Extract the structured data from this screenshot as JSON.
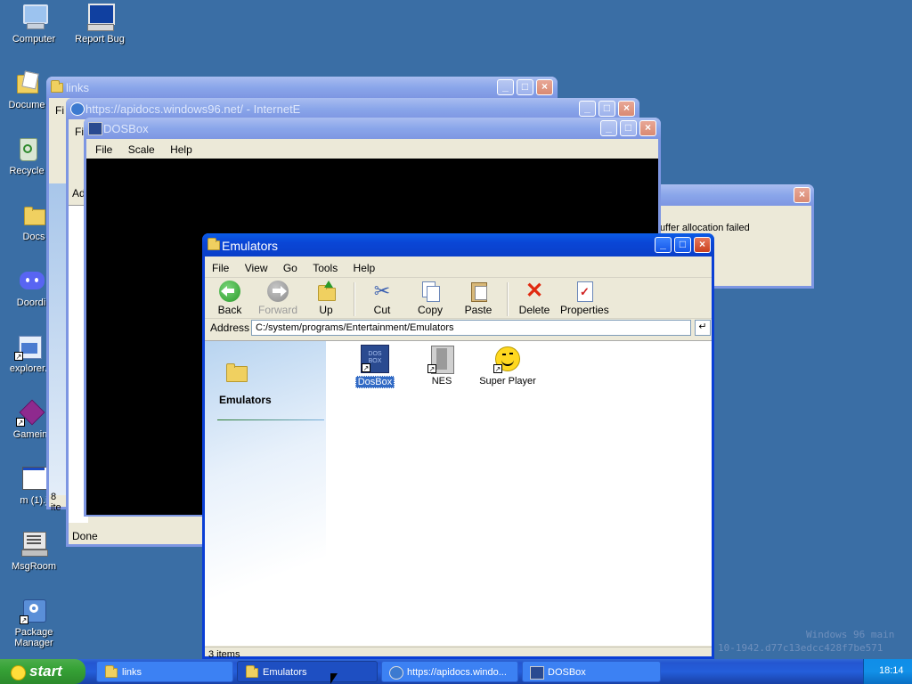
{
  "desktop": {
    "icons": [
      {
        "label": "Computer",
        "icon": "computer-icon"
      },
      {
        "label": "Report Bug",
        "icon": "report-bug-icon"
      },
      {
        "label": "Docume",
        "icon": "documents-icon"
      },
      {
        "label": "Recycle",
        "icon": "recycle-bin-icon"
      },
      {
        "label": "Docs",
        "icon": "folder-icon"
      },
      {
        "label": "Doordi",
        "icon": "discord-icon"
      },
      {
        "label": "explorer.",
        "icon": "explorer-icon"
      },
      {
        "label": "Gamein",
        "icon": "game-cube-icon"
      },
      {
        "label": "m (1).j",
        "icon": "image-file-icon"
      },
      {
        "label": "MsgRoom",
        "icon": "msgroom-icon"
      },
      {
        "label": "Package Manager",
        "icon": "package-manager-icon"
      }
    ],
    "watermark": {
      "line1": "Windows 96 main",
      "line2": "10-1942.d77c13edcc428f7be571"
    }
  },
  "links_window": {
    "title": "links",
    "menu_partial": "Fi",
    "status_partial": "8 ite"
  },
  "ie_window": {
    "title": "https://apidocs.windows96.net/ - InternetE",
    "menu_partial": "Fi",
    "address_partial": "Ad",
    "status": "Done"
  },
  "dosbox_window": {
    "title": "DOSBox",
    "menu": [
      "File",
      "Scale",
      "Help"
    ]
  },
  "error_window": {
    "message": "uffer allocation failed"
  },
  "emulators_window": {
    "title": "Emulators",
    "menu": [
      "File",
      "View",
      "Go",
      "Tools",
      "Help"
    ],
    "toolbar": {
      "back": "Back",
      "forward": "Forward",
      "up": "Up",
      "cut": "Cut",
      "copy": "Copy",
      "paste": "Paste",
      "delete": "Delete",
      "properties": "Properties"
    },
    "address_label": "Address",
    "address_value": "C:/system/programs/Entertainment/Emulators",
    "sidebar_title": "Emulators",
    "files": [
      {
        "name": "DosBox",
        "selected": true,
        "icon": "dosbox-icon"
      },
      {
        "name": "NES",
        "selected": false,
        "icon": "nes-icon"
      },
      {
        "name": "Super Player",
        "selected": false,
        "icon": "super-player-icon"
      }
    ],
    "status": "3 items"
  },
  "taskbar": {
    "start_label": "start",
    "tasks": [
      {
        "label": "links",
        "icon": "folder-icon",
        "active": false
      },
      {
        "label": "Emulators",
        "icon": "folder-icon",
        "active": true
      },
      {
        "label": "https://apidocs.windo...",
        "icon": "internet-explorer-icon",
        "active": false
      },
      {
        "label": "DOSBox",
        "icon": "dosbox-icon",
        "active": false
      }
    ],
    "clock": "18:14"
  },
  "colors": {
    "desktop": "#3a6ea5",
    "titlebar_active": "#0a46d6",
    "titlebar_inactive": "#8aa6ea",
    "window_face": "#ece9d8",
    "start_button": "#36a236",
    "tray": "#1290e8"
  }
}
